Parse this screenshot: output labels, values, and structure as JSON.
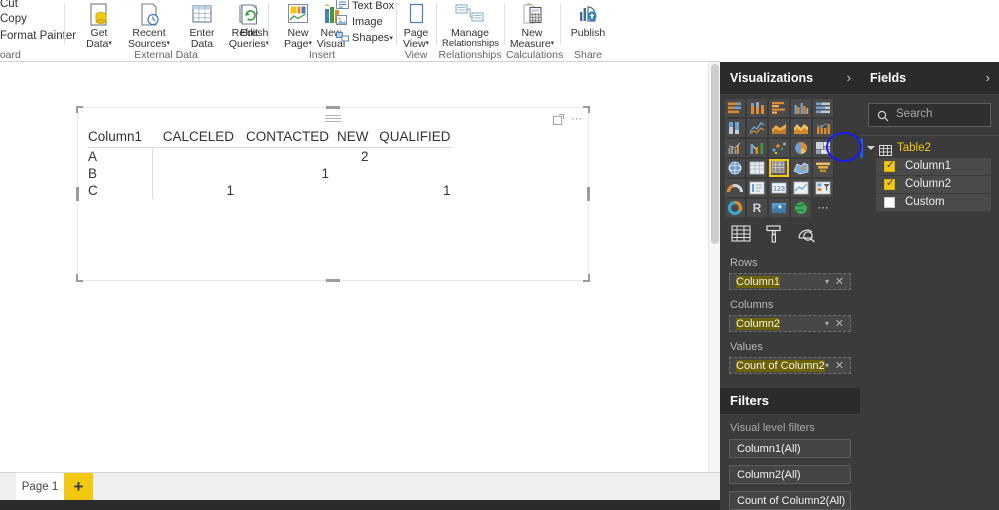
{
  "ribbon": {
    "clipboard_commands": [
      "Cut",
      "Copy",
      "Format Painter"
    ],
    "groups": [
      {
        "caption": "board",
        "full_caption": "Clipboard"
      },
      {
        "caption": "External Data"
      },
      {
        "caption": "Insert"
      },
      {
        "caption": "View"
      },
      {
        "caption": "Relationships"
      },
      {
        "caption": "Calculations"
      },
      {
        "caption": "Share"
      }
    ],
    "buttons": {
      "get_data": {
        "line1": "Get",
        "line2": "Data",
        "icon": "get-data-icon",
        "caret": "▾"
      },
      "recent_sources": {
        "line1": "Recent",
        "line2": "Sources",
        "icon": "recent-sources-icon",
        "caret": "▾"
      },
      "enter_data": {
        "line1": "Enter",
        "line2": "Data",
        "icon": "enter-data-icon",
        "caret": ""
      },
      "edit_queries": {
        "line1": "Edit",
        "line2": "Queries",
        "icon": "edit-queries-icon",
        "caret": "▾"
      },
      "refresh": {
        "line1": "Refresh",
        "line2": "",
        "icon": "refresh-icon",
        "caret": ""
      },
      "new_page": {
        "line1": "New",
        "line2": "Page",
        "icon": "new-page-icon",
        "caret": "▾"
      },
      "new_visual": {
        "line1": "New",
        "line2": "Visual",
        "icon": "new-visual-icon",
        "caret": ""
      },
      "page_view": {
        "line1": "Page",
        "line2": "View",
        "icon": "page-view-icon",
        "caret": "▾"
      },
      "manage_relationships": {
        "line1": "Manage",
        "line2": "Relationships",
        "icon": "manage-relationships-icon",
        "caret": ""
      },
      "new_measure": {
        "line1": "New",
        "line2": "Measure",
        "icon": "new-measure-icon",
        "caret": "▾"
      },
      "publish": {
        "line1": "Publish",
        "line2": "",
        "icon": "publish-icon",
        "caret": ""
      },
      "text_box": {
        "label": "Text Box",
        "icon": "text-box-icon"
      },
      "image": {
        "label": "Image",
        "icon": "image-icon"
      },
      "shapes": {
        "label": "Shapes",
        "icon": "shapes-icon",
        "caret": "▾"
      }
    }
  },
  "visual": {
    "focus_icon": "focus-mode-icon",
    "more_icon": "more-options-icon",
    "drag_handle": "drag-handle-icon"
  },
  "chart_data": {
    "type": "table",
    "title": "",
    "row_field": "Column1",
    "column_field": "Column2",
    "value_field": "Count of Column2",
    "columns": [
      "Column1",
      "CALCELED",
      "CONTACTED",
      "NEW",
      "QUALIFIED"
    ],
    "rows": [
      {
        "label": "A",
        "values": [
          "",
          "",
          "2",
          ""
        ]
      },
      {
        "label": "B",
        "values": [
          "",
          "1",
          "",
          ""
        ]
      },
      {
        "label": "C",
        "values": [
          "1",
          "",
          "",
          "1"
        ]
      }
    ]
  },
  "tabbar": {
    "pages": [
      {
        "label": "Page 1",
        "active": true
      }
    ],
    "add_label": "+"
  },
  "visualizations": {
    "title": "Visualizations",
    "collapse_chevron": "›",
    "icon_rows": [
      [
        "stacked-bar-chart-icon",
        "stacked-column-chart-icon",
        "clustered-bar-chart-icon",
        "clustered-column-chart-icon",
        "100-stacked-bar-chart-icon",
        "100-stacked-column-chart-icon"
      ],
      [
        "line-chart-icon",
        "area-chart-icon",
        "stacked-area-chart-icon",
        "line-stacked-column-chart-icon",
        "line-clustered-column-chart-icon",
        "ribbon-chart-icon"
      ],
      [
        "scatter-chart-icon",
        "pie-chart-icon",
        "treemap-icon",
        "map-icon",
        "table-icon",
        "matrix-icon"
      ],
      [
        "filled-map-icon",
        "funnel-icon",
        "gauge-icon",
        "multi-row-card-icon",
        "card-icon",
        "kpi-icon"
      ],
      [
        "slicer-icon",
        "donut-chart-icon",
        "r-script-visual-icon",
        "arcgis-map-icon",
        "globe-map-icon",
        "more-visuals-icon"
      ]
    ],
    "selected_icon": "matrix-icon",
    "tool_tabs": [
      "fields-pane-icon",
      "format-pane-icon",
      "analytics-pane-icon"
    ],
    "wells": [
      {
        "label": "Rows",
        "value": "Column1",
        "caret": "▾",
        "remove": "✕"
      },
      {
        "label": "Columns",
        "value": "Column2",
        "caret": "▾",
        "remove": "✕"
      },
      {
        "label": "Values",
        "value": "Count of Column2",
        "caret": "▾",
        "remove": "✕"
      }
    ]
  },
  "filters": {
    "title": "Filters",
    "subtitle": "Visual level filters",
    "cards": [
      "Column1(All)",
      "Column2(All)",
      "Count of Column2(All)"
    ]
  },
  "fields": {
    "title": "Fields",
    "collapse_chevron": "›",
    "search_placeholder": "Search",
    "search_icon": "search-icon",
    "tables": [
      {
        "name": "Table2",
        "icon": "table-grid-icon",
        "expanded": true,
        "columns": [
          {
            "label": "Column1",
            "checked": true
          },
          {
            "label": "Column2",
            "checked": true
          },
          {
            "label": "Custom",
            "checked": false
          }
        ]
      }
    ]
  },
  "annotation": {
    "shape": "ellipse",
    "color": "#1a1af0",
    "target": "matrix-icon"
  },
  "colors": {
    "accent_yellow": "#f2c811",
    "panel_bg": "#3b3b3b",
    "panel_header_bg": "#2b2b2b",
    "annotation_blue": "#1a1af0",
    "highlight_yellow": "#6b6100"
  }
}
